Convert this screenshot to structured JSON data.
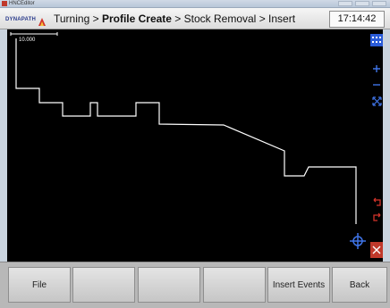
{
  "window": {
    "title": "HNCEditor"
  },
  "header": {
    "brand": "DYNAPATH",
    "breadcrumb": {
      "first": "Turning",
      "sep1": " > ",
      "current": "Profile Create",
      "sep2": " > ",
      "third": "Stock Removal",
      "sep3": " > ",
      "fourth": "Insert"
    },
    "time": "17:14:42"
  },
  "canvas": {
    "scale_label": "10.000",
    "tools": [
      "grid-icon",
      "zoom-in-icon",
      "zoom-out-icon",
      "fit-icon",
      "undo-icon",
      "redo-icon",
      "crosshair-icon",
      "close-icon"
    ]
  },
  "softkeys": [
    {
      "label": "File"
    },
    {
      "label": ""
    },
    {
      "label": ""
    },
    {
      "label": ""
    },
    {
      "label": "Insert Events"
    },
    {
      "label": "Back"
    }
  ],
  "colors": {
    "canvas_bg": "#000000",
    "accent_blue": "#2a5bd7",
    "accent_red": "#c0392b",
    "profile": "#ffffff"
  }
}
